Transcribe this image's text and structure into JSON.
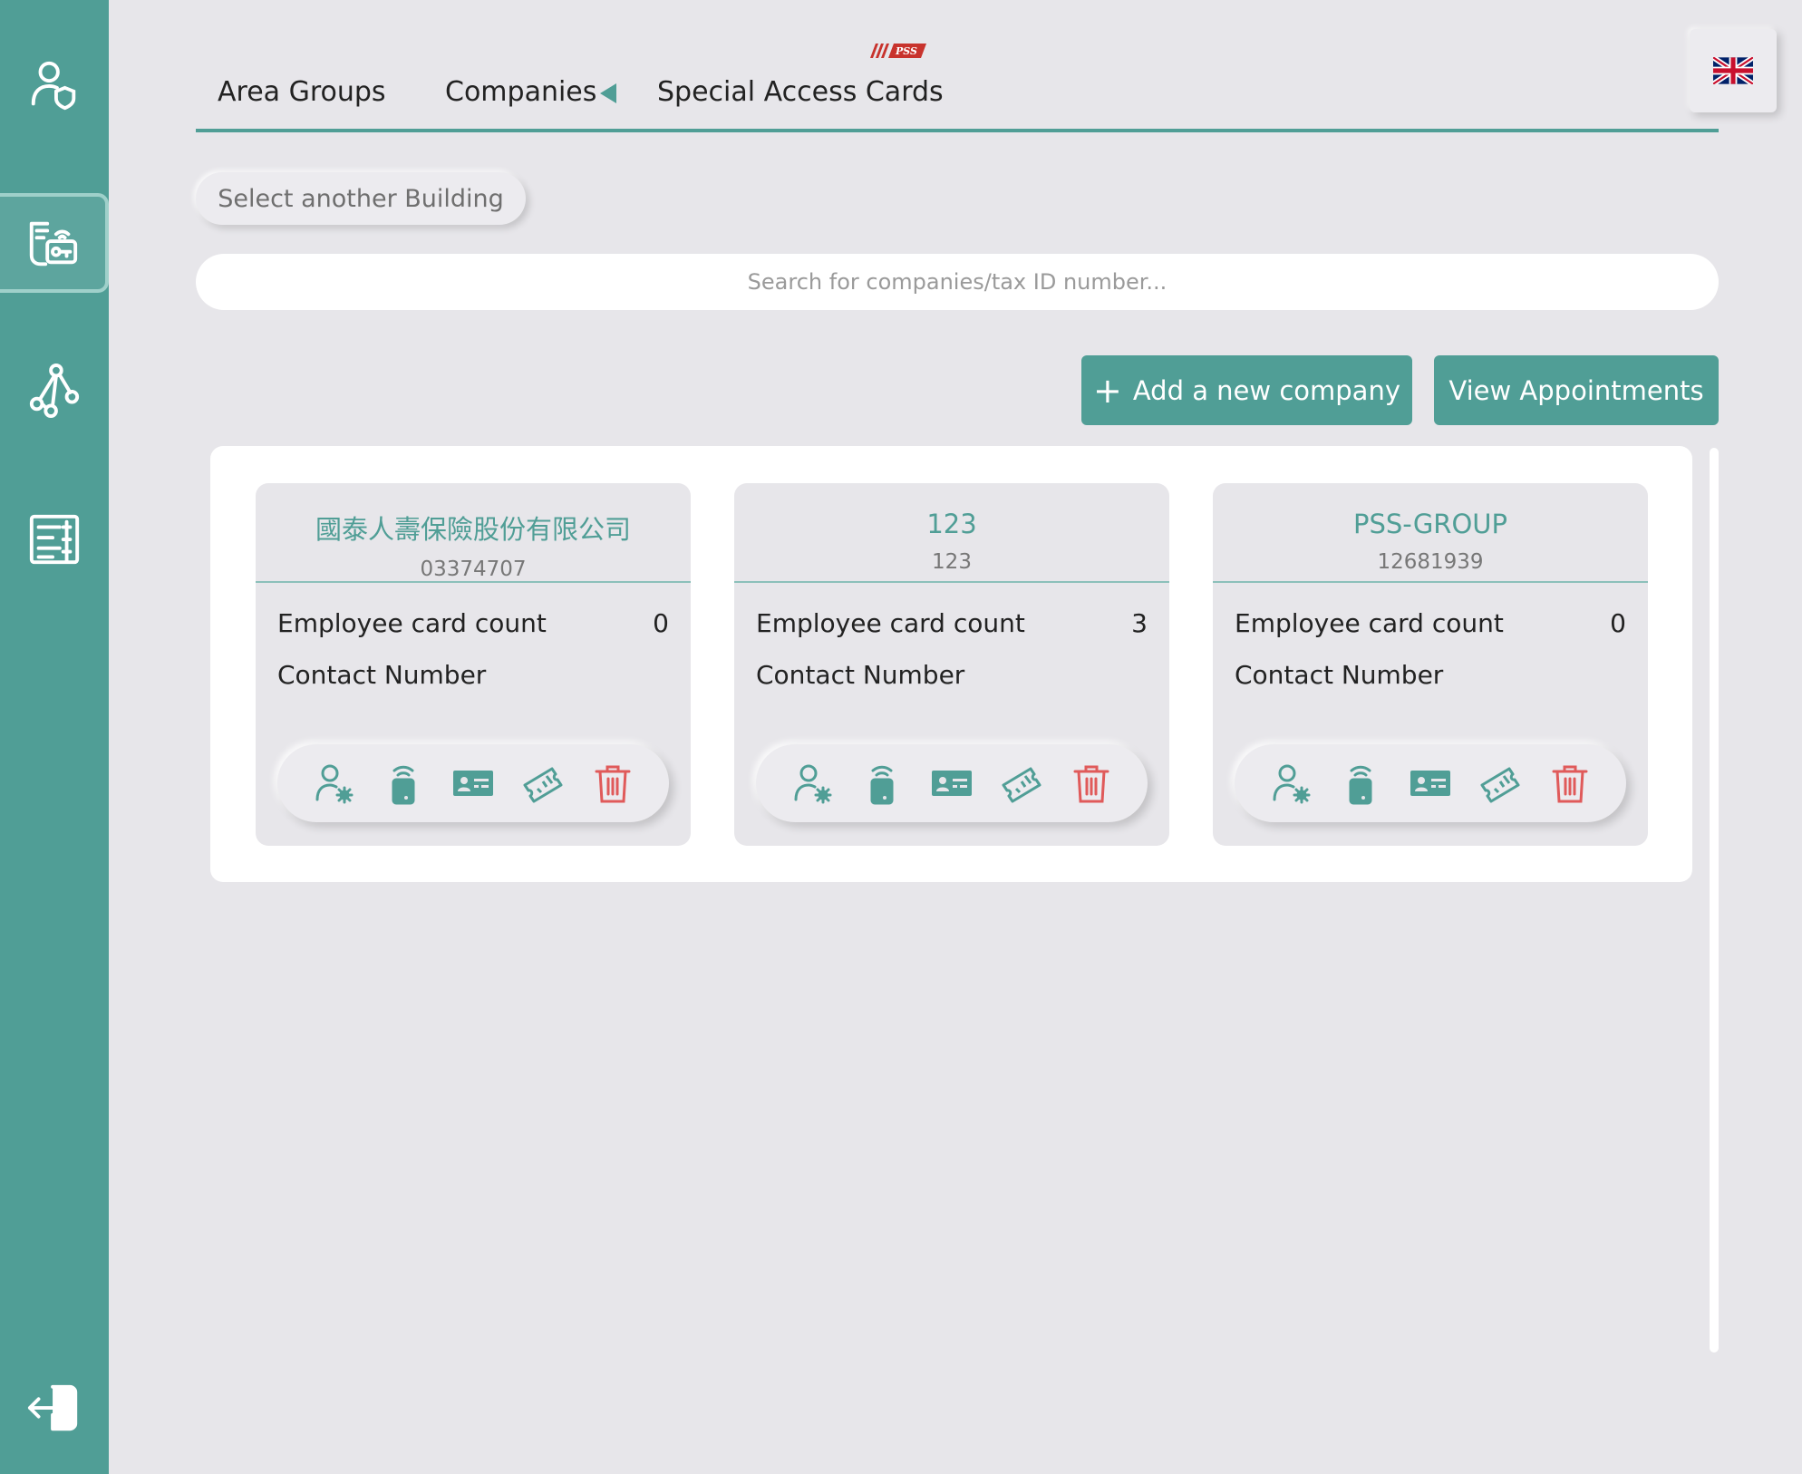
{
  "colors": {
    "accent": "#509e96",
    "danger": "#e05a5a",
    "background": "#e7e6ea"
  },
  "sidebar": {
    "items": [
      {
        "icon": "user-shield-icon"
      },
      {
        "icon": "card-key-icon",
        "active": true
      },
      {
        "icon": "network-icon"
      },
      {
        "icon": "list-document-icon"
      }
    ],
    "logout_icon": "logout-icon"
  },
  "header": {
    "logo_text": "PSS",
    "tabs": [
      "Area Groups",
      "Companies",
      "Special Access Cards"
    ],
    "active_tab": "Companies",
    "language_icon": "uk-flag-icon"
  },
  "toolbar": {
    "select_building": "Select another Building",
    "search_placeholder": "Search for companies/tax ID number...",
    "add_company": "Add a new company",
    "add_icon": "+",
    "view_appointments": "View Appointments"
  },
  "labels": {
    "employee_card_count": "Employee card count",
    "contact_number": "Contact Number"
  },
  "companies": [
    {
      "name": "國泰人壽保險股份有限公司",
      "tax_id": "03374707",
      "employee_card_count": "0",
      "contact_number": ""
    },
    {
      "name": "123",
      "tax_id": "123",
      "employee_card_count": "3",
      "contact_number": ""
    },
    {
      "name": "PSS-GROUP",
      "tax_id": "12681939",
      "employee_card_count": "0",
      "contact_number": ""
    }
  ],
  "card_actions": [
    "user-settings-icon",
    "rfid-card-icon",
    "id-card-icon",
    "ticket-icon",
    "trash-icon"
  ]
}
